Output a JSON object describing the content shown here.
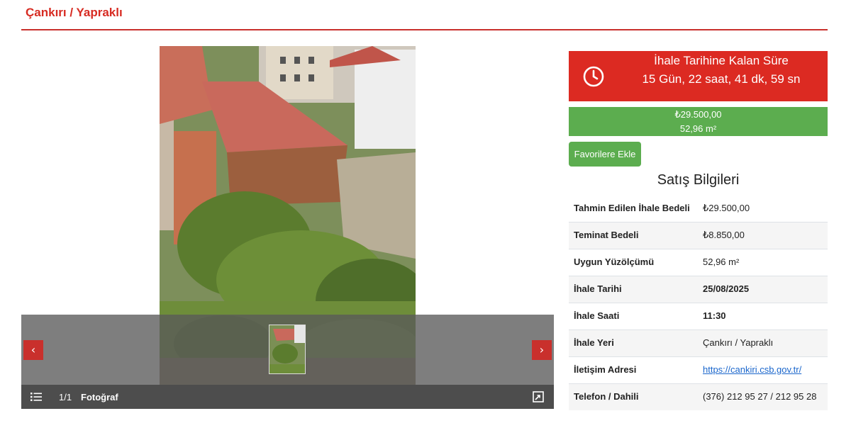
{
  "header": {
    "title": "Çankırı / Yapraklı"
  },
  "gallery": {
    "counter": "1/1",
    "caption": "Fotoğraf",
    "prev_label": "‹",
    "next_label": "›"
  },
  "countdown": {
    "title": "İhale Tarihine Kalan Süre",
    "value": "15 Gün, 22 saat, 41 dk, 59 sn",
    "color": "#dc2a22"
  },
  "price": {
    "amount": "₺29.500,00",
    "area": "52,96 m²",
    "color": "#5cad4f"
  },
  "favorite_button": {
    "label": "Favorilere Ekle"
  },
  "sale_info": {
    "title": "Satış Bilgileri",
    "rows": [
      {
        "key": "Tahmin Edilen İhale Bedeli",
        "value": "₺29.500,00"
      },
      {
        "key": "Teminat Bedeli",
        "value": "₺8.850,00"
      },
      {
        "key": "Uygun Yüzölçümü",
        "value": "52,96 m²"
      },
      {
        "key": "İhale Tarihi",
        "value": "25/08/2025"
      },
      {
        "key": "İhale Saati",
        "value": "11:30"
      },
      {
        "key": "İhale Yeri",
        "value": "Çankırı / Yapraklı"
      },
      {
        "key": "İletişim Adresi",
        "value": "https://cankiri.csb.gov.tr/"
      },
      {
        "key": "Telefon / Dahili",
        "value": "(376) 212 95 27 / 212 95 28"
      }
    ]
  },
  "icons": [
    "clock-icon",
    "list-icon",
    "expand-icon",
    "chevron-left-icon",
    "chevron-right-icon"
  ]
}
